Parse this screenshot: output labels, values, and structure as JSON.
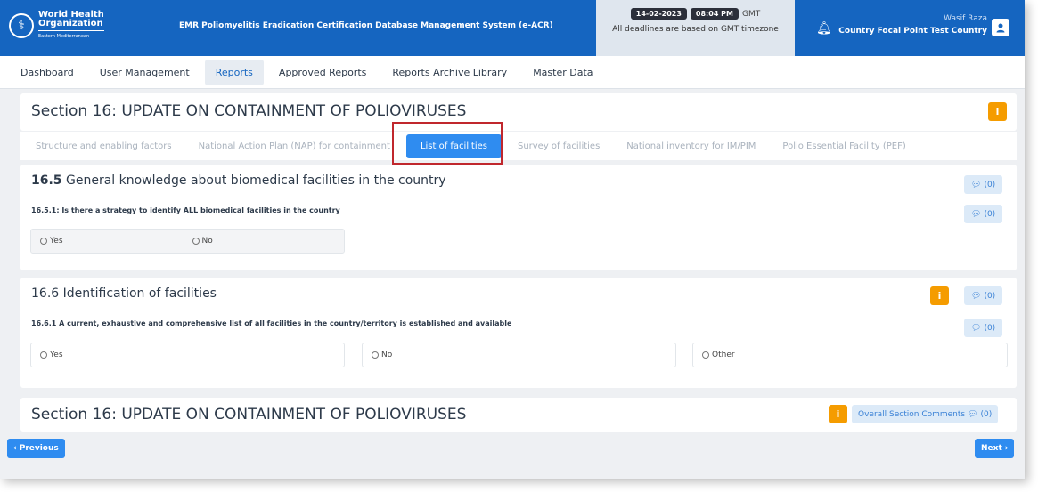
{
  "header": {
    "logo_line1": "World Health",
    "logo_line2": "Organization",
    "logo_line3": "Eastern Mediterranean",
    "app_title": "EMR Poliomyelitis Eradication Certification Database Management System (e-ACR)",
    "date": "14-02-2023",
    "time": "08:04 PM",
    "timezone": "GMT",
    "deadline_note": "All deadlines are based on GMT timezone",
    "user_name": "Wasif Raza",
    "user_role": "Country Focal Point Test Country",
    "bell_icon": "bell-icon",
    "avatar_icon": "user-icon"
  },
  "nav": {
    "items": [
      "Dashboard",
      "User Management",
      "Reports",
      "Approved Reports",
      "Reports Archive Library",
      "Master Data"
    ],
    "active_index": 2
  },
  "section": {
    "title": "Section 16: UPDATE ON CONTAINMENT OF POLIOVIRUSES",
    "subtabs": [
      "Structure and enabling factors",
      "National Action Plan (NAP) for containment",
      "List of facilities",
      "Survey of facilities",
      "National inventory for IM/PIM",
      "Polio Essential Facility (PEF)"
    ],
    "active_subtab": 2
  },
  "q165": {
    "num": "16.5",
    "title": "General knowledge about biomedical facilities in the country",
    "comment_count": "(0)",
    "sub_question": "16.5.1: Is there a strategy to identify ALL biomedical facilities in the country",
    "sub_comment_count": "(0)",
    "options": [
      "Yes",
      "No"
    ]
  },
  "q166": {
    "title": "16.6 Identification of facilities",
    "comment_count": "(0)",
    "sub_question": "16.6.1 A current, exhaustive and comprehensive list of all facilities in the country/territory is established and available",
    "sub_comment_count": "(0)",
    "options": [
      "Yes",
      "No",
      "Other"
    ]
  },
  "footer": {
    "title": "Section 16: UPDATE ON CONTAINMENT OF POLIOVIRUSES",
    "overall_comments_label": "Overall Section Comments",
    "comment_count": "(0)",
    "previous_label": "Previous",
    "next_label": "Next"
  },
  "colors": {
    "primary": "#1565c0",
    "accent_button": "#2f8cf0",
    "info": "#f59c00",
    "highlight_border": "#c0272d"
  }
}
